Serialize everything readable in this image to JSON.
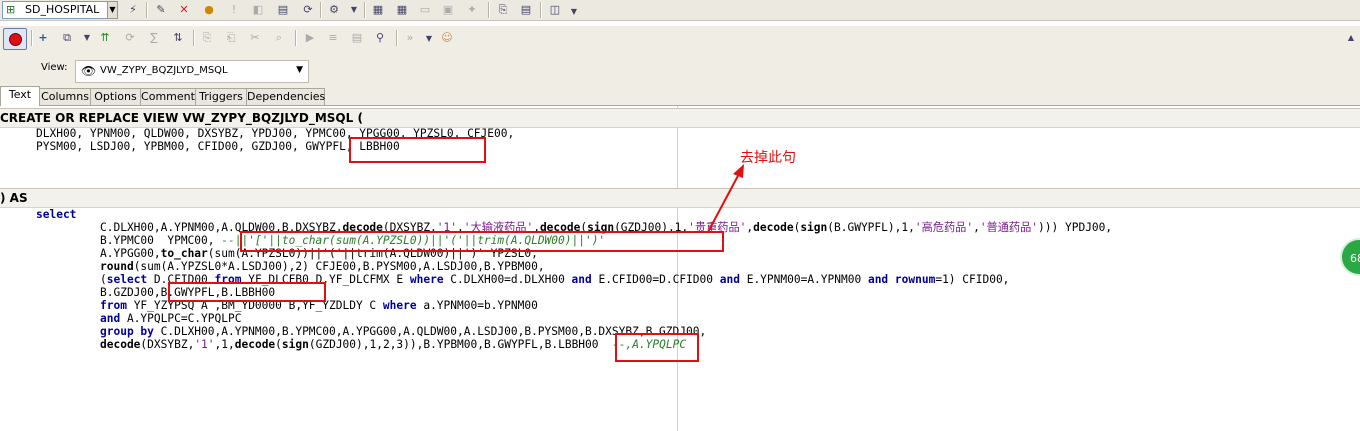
{
  "toolbar1": {
    "connection": "SD_HOSPITAL",
    "icons": [
      "connection-icon",
      "dropdown-arrow-icon",
      "query-icon",
      "edit-icon",
      "cross-icon",
      "bulb-icon",
      "exclamation-icon",
      "sql-icon",
      "ddl-icon",
      "refresh-icon",
      "tools-icon",
      "dropdown-icon",
      "table-icon",
      "grid-icon",
      "form-icon",
      "print-icon",
      "settings-icon",
      "export-icon",
      "options-icon",
      "chart-icon",
      "dropdown-icon"
    ]
  },
  "toolbar2": {
    "icons": [
      "record-icon",
      "add-icon",
      "duplicate-icon",
      "dropdown-icon",
      "compile-icon",
      "recompile-icon",
      "sql-icon",
      "sort-icon",
      "copy-icon",
      "paste-icon",
      "cut-icon",
      "find-icon",
      "execute-icon",
      "step-icon",
      "breakpoint-icon",
      "binoculars-icon",
      "more-icon",
      "dropdown-icon",
      "help-icon"
    ]
  },
  "view": {
    "label": "View:",
    "name": "VW_ZYPY_BQZJLYD_MSQL"
  },
  "tabs": [
    "Text",
    "Columns",
    "Options",
    "Comment",
    "Triggers",
    "Dependencies"
  ],
  "editor": {
    "header1": "CREATE OR REPLACE VIEW VW_ZYPY_BQZJLYD_MSQL (",
    "col_line1": "DLXH00, YPNM00, QLDW00, DXSYBZ, YPDJ00, YPMC00, YPGG00, YPZSL0, CFJE00,",
    "col_line2a": "PYSM00, LSDJ00, YPBM00, CFID00, GZDJ00, ",
    "col_line2b": "GWYPFL, LBBH00",
    "header2": ") AS",
    "kw_select": "select",
    "l1a": "C.DLXH00,A.YPNM00,A.QLDW00,B.DXSYBZ,",
    "l1_decode": "decode",
    "l1b": "(DXSYBZ,",
    "l1_s1": "'1'",
    "l1c": ",",
    "l1_s2": "'大输液药品'",
    "l1d": ",",
    "l1_decode2": "decode",
    "l1e": "(",
    "l1_sign": "sign",
    "l1f": "(GZDJ00),1,",
    "l1_s3": "'贵重药品'",
    "l1g": ",",
    "l1_decode3": "decode",
    "l1h": "(",
    "l1_sign2": "sign",
    "l1i": "(B.GWYPFL),1,",
    "l1_s4": "'高危药品'",
    "l1j": ",",
    "l1_s5": "'普通药品'",
    "l1k": "))) YPDJ00,",
    "l2a": "B.YPMC00  YPMC00, ",
    "l2_cm": "--||'['||to_char(sum(A.YPZSL0))||'('||trim(A.QLDW00)||')'",
    "l3a": "A.YPGG00,",
    "l3_fn": "to_char",
    "l3b": "(sum(A.YPZSL0))||'('||trim(A.QLDW00)||')' YPZSL0,",
    "l4_fn": "round",
    "l4b": "(sum(A.YPZSL0*A.LSDJ00),2) CFJE00,B.PYSM00,A.LSDJ00,B.YPBM00,",
    "l5a": "(",
    "l5_select": "select",
    "l5b": " D.CFID00 ",
    "l5_from": "from",
    "l5c": " YF_DLCFB0 D,YF_DLCFMX E ",
    "l5_where": "where",
    "l5d": " C.DLXH00=d.DLXH00 ",
    "l5_and": "and",
    "l5e": " E.CFID00=D.CFID00 ",
    "l5_and2": "and",
    "l5f": " E.YPNM00=A.YPNM00 ",
    "l5_and3": "and",
    "l5_rownum": " rownum",
    "l5g": "=1) CFID00,",
    "l6a": "B.GZDJ00,",
    "l6b": "B.GWYPFL,B.LBBH00",
    "l7_from": "from",
    "l7b": " YF_YZYPSQ A ,BM_YD0000 B,YF_YZDLDY C ",
    "l7_where": "where",
    "l7c": " a.YPNM00=b.YPNM00",
    "l8_and": "and",
    "l8b": " A.YPQLPC=C.YPQLPC",
    "l9_group": "group by",
    "l9b": " C.DLXH00,A.YPNM00,B.YPMC00,A.YPGG00,A.QLDW00,A.LSDJ00,B.PYSM00,B.DXSYBZ,B.GZDJ00,",
    "l10_decode": "decode",
    "l10b": "(DXSYBZ,",
    "l10_s1": "'1'",
    "l10c": ",1,",
    "l10_decode2": "decode",
    "l10d": "(",
    "l10_sign": "sign",
    "l10e": "(GZDJ00),1,2,3)),B.YPBM00,B.GWYPFL",
    "l10f": ",B.LBBH00",
    "l10_cm": "  --,A.YPQLPC"
  },
  "annotation": "去掉此句",
  "side_badge": "68",
  "colors": {
    "annotation": "#e01010",
    "keyword": "#00009a",
    "string": "#7a1c8c",
    "comment": "#2a7d2a"
  }
}
